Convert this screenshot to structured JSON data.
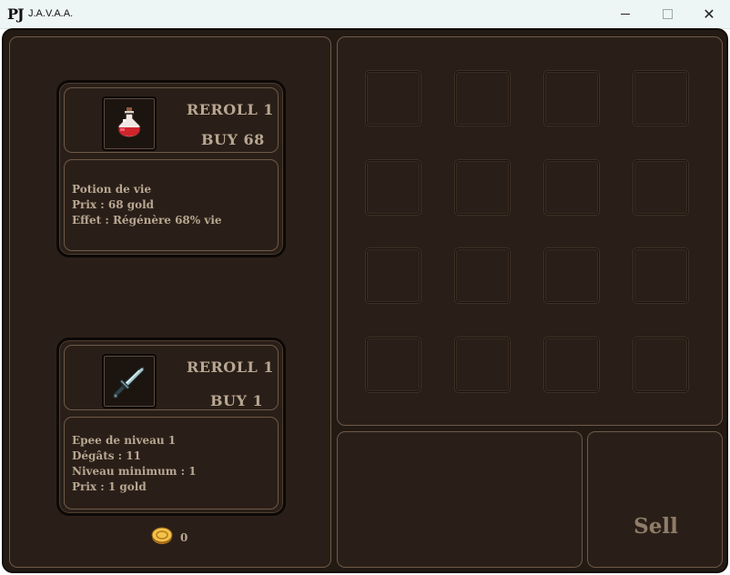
{
  "window": {
    "logo": "PJ",
    "title": "J.A.V.A.A.",
    "minimize_icon": "minimize-icon",
    "maximize_icon": "maximize-icon",
    "close_icon": "close-icon",
    "close_glyph": "✕"
  },
  "shop": {
    "cards": [
      {
        "item_icon": "red-potion-icon",
        "reroll_label": "REROLL 1",
        "buy_label": "BUY 68",
        "description": [
          "Potion de vie",
          "Prix : 68 gold",
          "Effet : Régénère 68% vie"
        ]
      },
      {
        "item_icon": "sword-icon",
        "reroll_label": "REROLL 1",
        "buy_label": "BUY 1",
        "description": [
          "Epee de niveau 1",
          "Dégâts : 11",
          "Niveau minimum : 1",
          "Prix : 1 gold"
        ]
      }
    ],
    "gold": {
      "icon": "gold-coin-icon",
      "amount": "0"
    }
  },
  "inventory": {
    "rows": 4,
    "columns": 4,
    "slots_filled": 0
  },
  "sell": {
    "label": "Sell"
  },
  "colors": {
    "background": "#231a14",
    "panel": "#2a1f18",
    "border": "#6e5a48",
    "text": "#b8a792",
    "sell_text": "#8f7d6a",
    "titlebar": "#eef6f5"
  }
}
